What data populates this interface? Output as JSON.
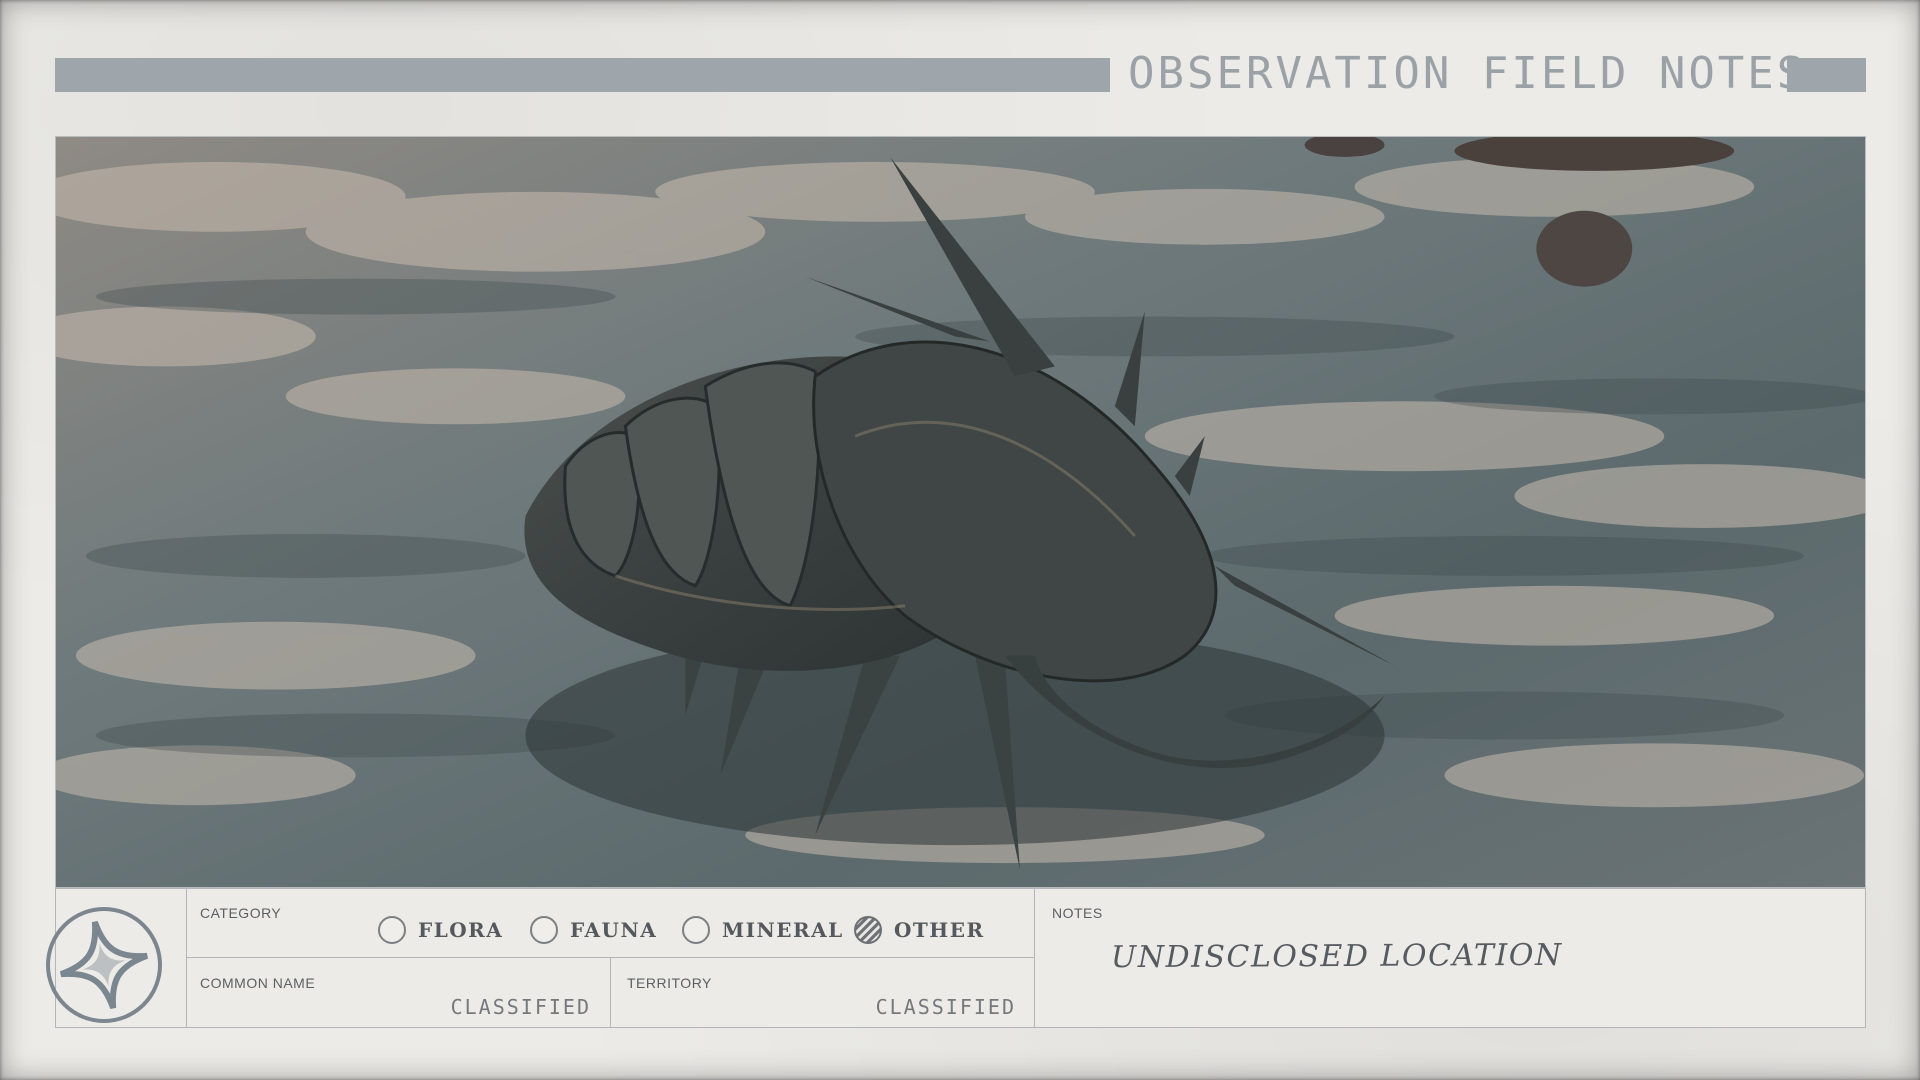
{
  "header": {
    "title": "OBSERVATION FIELD NOTES"
  },
  "photo": {
    "icon": "creature-photo-image"
  },
  "form": {
    "emblem_icon": "four-point-star-emblem-icon",
    "category": {
      "label": "CATEGORY",
      "options": [
        {
          "label": "FLORA",
          "checked": false
        },
        {
          "label": "FAUNA",
          "checked": false
        },
        {
          "label": "MINERAL",
          "checked": false
        },
        {
          "label": "OTHER",
          "checked": true
        }
      ]
    },
    "common_name": {
      "label": "COMMON NAME",
      "value": "CLASSIFIED"
    },
    "territory": {
      "label": "TERRITORY",
      "value": "CLASSIFIED"
    },
    "notes": {
      "label": "NOTES",
      "value": "UNDISCLOSED LOCATION"
    }
  }
}
